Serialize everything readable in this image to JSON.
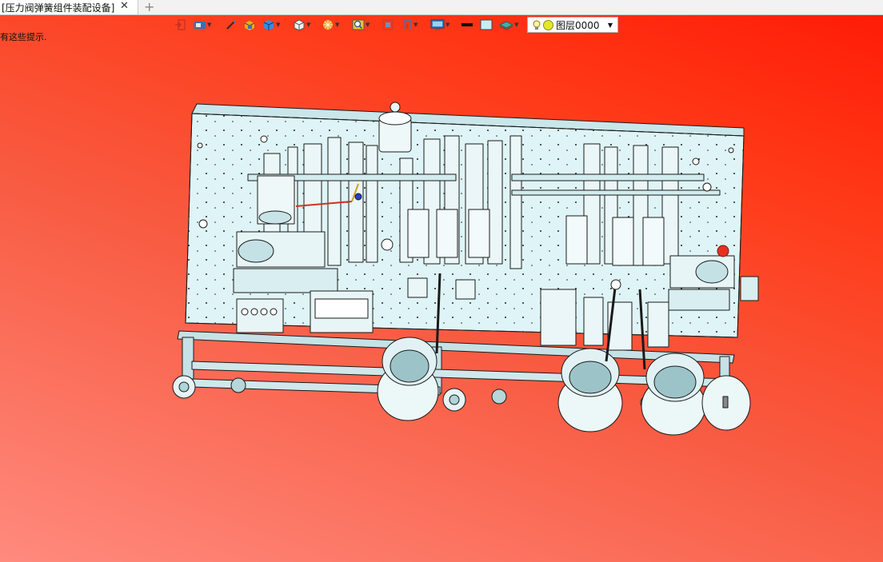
{
  "tab": {
    "title": "[压力阀弹簧组件装配设备]",
    "close": "✕",
    "add": "+"
  },
  "hint_text": "有这些提示.",
  "toolbar": {
    "items": [
      {
        "name": "exit-sketch-icon",
        "dropdown": false
      },
      {
        "name": "display-style-icon",
        "dropdown": true
      },
      {
        "name": "pen-icon",
        "dropdown": false
      },
      {
        "name": "material-icon",
        "dropdown": false
      },
      {
        "name": "shaded-box-icon",
        "dropdown": true
      },
      {
        "name": "view-cube-icon",
        "dropdown": true
      },
      {
        "name": "render-icon",
        "dropdown": true
      },
      {
        "name": "zoom-icon",
        "dropdown": true
      },
      {
        "name": "fit-view-icon",
        "dropdown": false
      },
      {
        "name": "section-icon",
        "dropdown": true
      },
      {
        "name": "monitor-icon",
        "dropdown": true
      },
      {
        "name": "line-color-icon",
        "dropdown": false
      },
      {
        "name": "fill-color-icon",
        "dropdown": false
      },
      {
        "name": "layer-manager-icon",
        "dropdown": true
      }
    ],
    "layer": {
      "name": "图层0000",
      "dropdown": "▼"
    }
  },
  "colors": {
    "background_top": "#ff1a05",
    "background_bottom": "#ff8a7e",
    "model_fill": "#dff4f6",
    "model_edge": "#1a1a1a"
  }
}
